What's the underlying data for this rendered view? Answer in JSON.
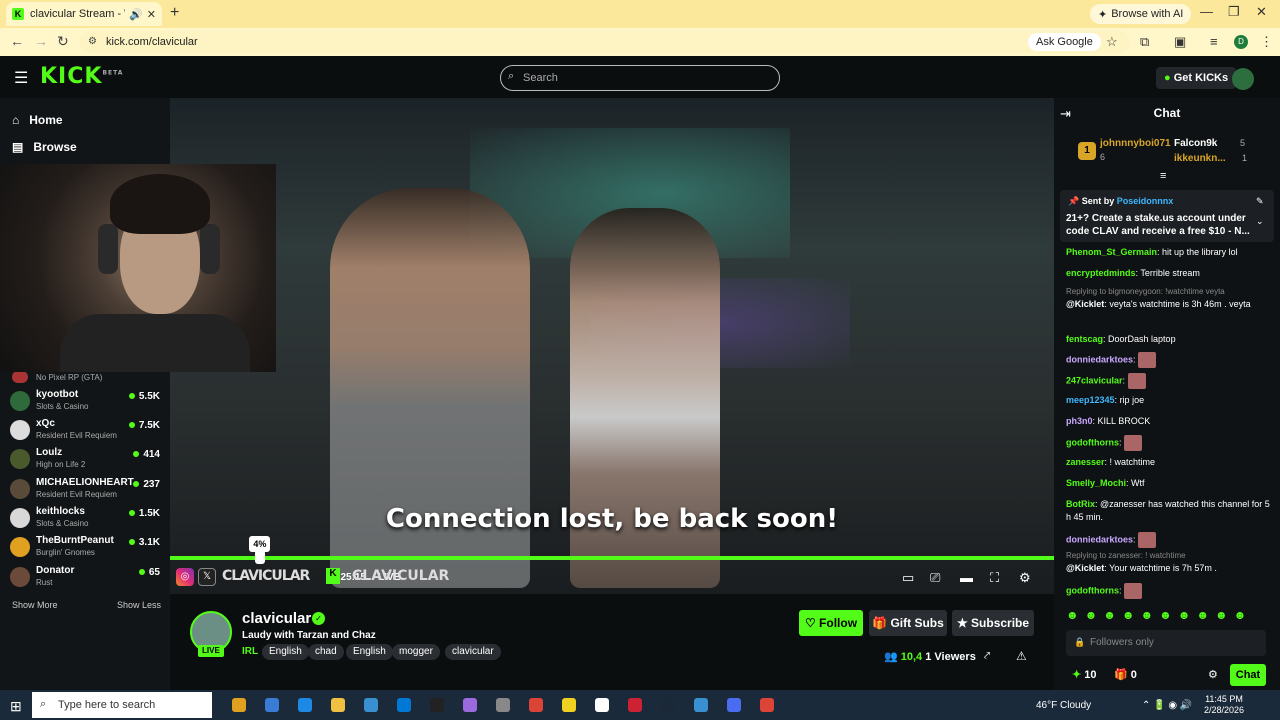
{
  "browser": {
    "tab_title": "clavicular Stream - Watch L",
    "tab_favicon_letter": "K",
    "url": "kick.com/clavicular",
    "browse_ai": "Browse with AI",
    "ask_google": "Ask Google",
    "profile_letter": "D"
  },
  "header": {
    "logo": "KICK",
    "logo_beta": "BETA",
    "search_placeholder": "Search",
    "get_kicks": "Get KICKs"
  },
  "sidebar": {
    "nav": [
      {
        "label": "Home",
        "icon": "home-icon"
      },
      {
        "label": "Browse",
        "icon": "compass-icon"
      }
    ],
    "partial_category": "No Pixel RP (GTA)",
    "streamers": [
      {
        "name": "kyootbot",
        "category": "Slots & Casino",
        "viewers": "5.5K",
        "color": "#2f6b3a"
      },
      {
        "name": "xQc",
        "category": "Resident Evil Requiem",
        "viewers": "7.5K",
        "color": "#ddd"
      },
      {
        "name": "Loulz",
        "category": "High on Life 2",
        "viewers": "414",
        "color": "#4a5a2c"
      },
      {
        "name": "MICHAELIONHEART",
        "category": "Resident Evil Requiem",
        "viewers": "237",
        "color": "#5a4a3a"
      },
      {
        "name": "keithlocks",
        "category": "Slots & Casino",
        "viewers": "1.5K",
        "color": "#d8d8d8"
      },
      {
        "name": "TheBurntPeanut",
        "category": "Burglin' Gnomes",
        "viewers": "3.1K",
        "color": "#e0a020"
      },
      {
        "name": "Donator",
        "category": "Rust",
        "viewers": "65",
        "color": "#6b4a3a"
      }
    ],
    "show_more": "Show More",
    "show_less": "Show Less"
  },
  "player": {
    "message": "Connection lost, be back soon!",
    "progress_pct_label": "4%",
    "progress_fraction": 0.04,
    "overlay_left": "CLAVICULAR",
    "overlay_right": "CLAVICULAR",
    "timecode": "04:25:15",
    "live": "LIVE"
  },
  "channel": {
    "name": "clavicular",
    "title": "Laudy with Tarzan and Chaz",
    "category": "IRL",
    "tags": [
      "English",
      "chad",
      "English",
      "mogger",
      "clavicular"
    ],
    "live_badge": "LIVE",
    "follow": "Follow",
    "gift_subs": "Gift Subs",
    "subscribe": "Subscribe",
    "viewer_count": "10,4",
    "viewers_label": "1 Viewers"
  },
  "chat": {
    "title": "Chat",
    "leaderboard": {
      "rank": "1",
      "first_name": "johnnnyboi071",
      "first_count": "6",
      "second_name": "Falcon9k",
      "second_count": "5",
      "third_name": "ikkeunkn...",
      "third_count": "1"
    },
    "pinned": {
      "sent_by": "Sent by",
      "user": "Poseidonnnx",
      "text": "21+? Create a stake.us account under code CLAV and receive a free $10 - N..."
    },
    "messages": [
      {
        "user": "Phenom_St_Germain",
        "color": "#53fc18",
        "text": "hit up the library lol"
      },
      {
        "user": "encryptedminds",
        "color": "#53fc18",
        "text": "Terrible stream"
      },
      {
        "reply": "Replying to bigmoneygoon: !watchtime veyta"
      },
      {
        "user": "@Kicklet",
        "color": "#fff",
        "text": "veyta's watchtime is 3h 46m . veyta"
      },
      {
        "user": "fentscag",
        "color": "#53fc18",
        "text": "DoorDash laptop"
      },
      {
        "user": "donniedarktoes",
        "color": "#c9a8ff",
        "text": ""
      },
      {
        "user": "247clavicular",
        "color": "#53fc18",
        "text": ""
      },
      {
        "user": "meep12345",
        "color": "#3db7ff",
        "text": "rip joe"
      },
      {
        "user": "ph3n0",
        "color": "#c9a8ff",
        "text": "KILL BROCK"
      },
      {
        "user": "godofthorns",
        "color": "#53fc18",
        "text": ""
      },
      {
        "user": "zanesser",
        "color": "#53fc18",
        "text": "! watchtime"
      },
      {
        "user": "Smelly_Mochi",
        "color": "#53fc18",
        "text": "Wtf"
      },
      {
        "user": "BotRix",
        "color": "#53fc18",
        "text": "@zanesser has watched this channel for 5 h 45 min."
      },
      {
        "user": "donniedarktoes",
        "color": "#c9a8ff",
        "text": ""
      },
      {
        "reply": "Replying to zanesser: ! watchtime"
      },
      {
        "user": "@Kicklet",
        "color": "#fff",
        "text": "Your watchtime is 7h 57m ."
      },
      {
        "user": "godofthorns",
        "color": "#53fc18",
        "text": ""
      }
    ],
    "input_placeholder": "Followers only",
    "points": "10",
    "gifts": "0",
    "send": "Chat"
  },
  "taskbar": {
    "search_placeholder": "Type here to search",
    "weather": "46°F  Cloudy",
    "time": "11:45 PM",
    "date": "2/28/2026",
    "apps": [
      "#e0a020",
      "#3a7bd5",
      "#1e88e5",
      "#f0c040",
      "#3a8fd0",
      "#0078d4",
      "#222",
      "#9a6ade",
      "#888",
      "#db4437",
      "#f0d020",
      "#ffffff",
      "#c23",
      "#1b2838",
      "#3a8fd0",
      "#4a6cf0",
      "#db4437"
    ]
  }
}
